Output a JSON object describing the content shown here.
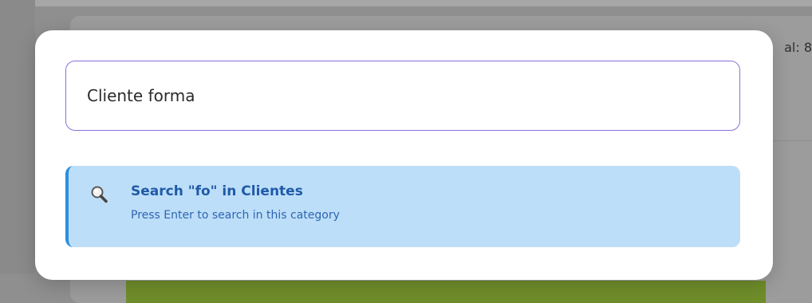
{
  "background": {
    "total_label": "al: 8"
  },
  "search": {
    "value": "Cliente forma",
    "placeholder": ""
  },
  "results": [
    {
      "icon": "search-icon",
      "title": "Search \"fo\" in Clientes",
      "subtitle": "Press Enter to search in this category"
    }
  ],
  "colors": {
    "input_border": "#8b6fdc",
    "result_bg": "#bddef8",
    "result_accent": "#2b8fe0",
    "result_text": "#1f5aa8",
    "background_green": "#6f8d2a"
  }
}
